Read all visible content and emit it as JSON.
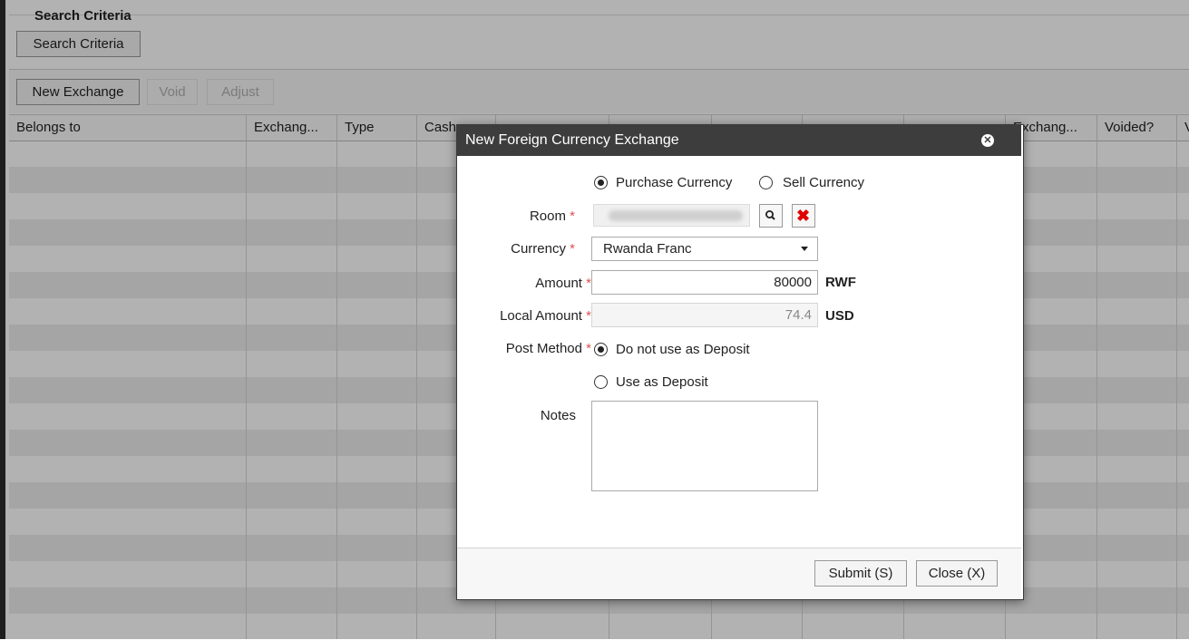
{
  "search_criteria": {
    "title": "Search Criteria",
    "button_label": "Search Criteria"
  },
  "toolbar": {
    "new_exchange": "New Exchange",
    "void": "Void",
    "adjust": "Adjust"
  },
  "grid": {
    "columns": [
      "Belongs to",
      "Exchang...",
      "Type",
      "Cash",
      "",
      "",
      "",
      "",
      "",
      "Exchang...",
      "Voided?",
      "V"
    ]
  },
  "dialog": {
    "title": "New Foreign Currency Exchange",
    "close_icon": "close-circle-icon",
    "transaction_type": {
      "options": [
        "Purchase Currency",
        "Sell Currency"
      ],
      "selected": "Purchase Currency"
    },
    "room": {
      "label": "Room"
    },
    "currency": {
      "label": "Currency",
      "value": "Rwanda Franc"
    },
    "amount": {
      "label": "Amount",
      "value": "80000",
      "unit": "RWF"
    },
    "local_amount": {
      "label": "Local Amount",
      "value": "74.4",
      "unit": "USD"
    },
    "post_method": {
      "label": "Post Method",
      "options": [
        "Do not use as Deposit",
        "Use as Deposit"
      ],
      "selected": "Do not use as Deposit"
    },
    "notes": {
      "label": "Notes",
      "value": ""
    },
    "required_marker": "*",
    "submit_label": "Submit (S)",
    "close_label": "Close (X)"
  },
  "colors": {
    "header_bg": "#3d3d3d",
    "required": "#d9534f",
    "clear_icon": "#e00000"
  }
}
